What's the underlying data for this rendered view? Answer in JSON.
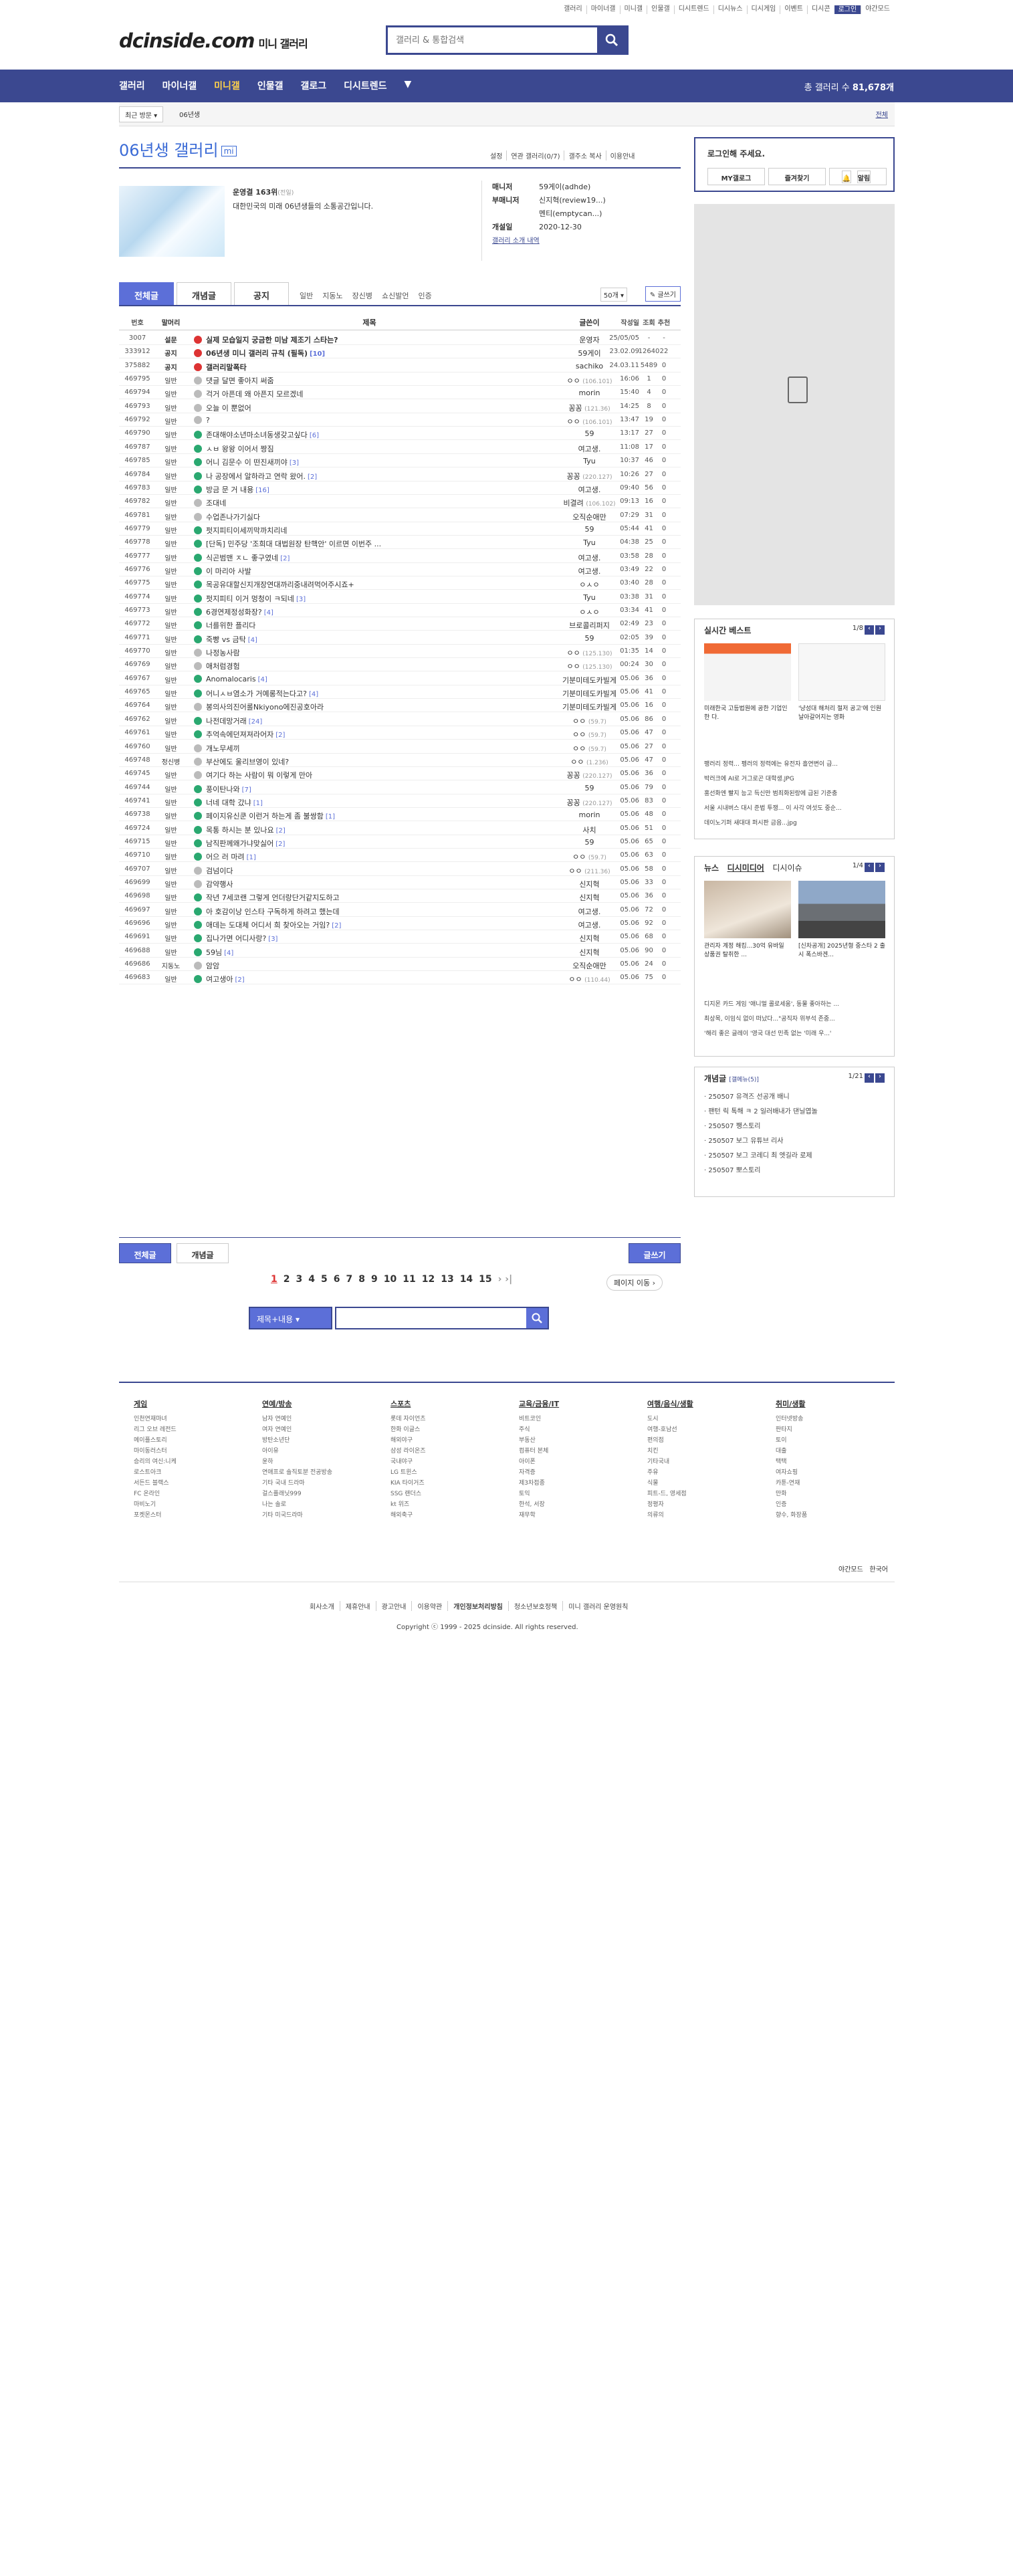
{
  "top_links": [
    "갤러리",
    "마이너갤",
    "미니갤",
    "인물갤",
    "디시트렌드",
    "디시뉴스",
    "디시게임",
    "이벤트",
    "디시콘",
    "로그인",
    "야간모드"
  ],
  "logo": "dcinside.com",
  "logo_sub": "미니 갤러리",
  "search_placeholder": "갤러리 & 통합검색",
  "nav": [
    "갤러리",
    "마이너갤",
    "미니갤",
    "인물갤",
    "갤로그",
    "디시트렌드"
  ],
  "nav_active": "미니갤",
  "nav_count_label": "총 갤러리 수",
  "nav_count": "81,678개",
  "breadcrumb": {
    "recent": "최근 방문",
    "item": "06년생",
    "all": "전체"
  },
  "gallery": {
    "title": "06년생 갤러리",
    "badge": "mi",
    "tools": [
      "설정",
      "연관 갤러리(0/7)",
      "갤주소 복사",
      "이용안내"
    ],
    "rank": "운영결 163위",
    "rank_note": "(전일)",
    "desc": "대한민국의 미래 06년생들의 소통공간입니다.",
    "manager_label": "매니저",
    "manager": "59게이(adhde)",
    "submanager_label": "부매니저",
    "submanager": "신지혁(review19...)",
    "submanager2": "멘티(emptycan...)",
    "opened_label": "개설일",
    "opened": "2020-12-30",
    "link": "갤러리 소개 내역"
  },
  "tabs": [
    "전체글",
    "개념글",
    "공지"
  ],
  "subtabs": [
    "일반",
    "지동노",
    "장신병",
    "쇼신발언",
    "인증"
  ],
  "list_count": "50개",
  "write_btn": "글쓰기",
  "header": [
    "번호",
    "말머리",
    "제목",
    "글쓴이",
    "작성일",
    "조회",
    "추천"
  ],
  "rows": [
    {
      "no": "3007",
      "h": "설문",
      "t": "실제 모습일지 궁금한 미남 제조기 스타는?",
      "w": "운영자",
      "d": "25/05/05",
      "v": "-",
      "r": "-",
      "ic": "r",
      "type": "notice"
    },
    {
      "no": "333912",
      "h": "공지",
      "t": "06년생 미니 갤러리 규칙 (필독)",
      "c": "[10]",
      "w": "59게이",
      "d": "23.02.09",
      "v": "12640",
      "r": "22",
      "ic": "r",
      "type": "notice"
    },
    {
      "no": "375882",
      "h": "공지",
      "t": "갤러리말폭타",
      "w": "sachiko",
      "d": "24.03.11",
      "v": "5489",
      "r": "0",
      "ic": "r",
      "type": "notice"
    },
    {
      "no": "469795",
      "h": "일반",
      "t": "댓글 달면 좋아지 써줌",
      "w": "ㅇㅇ",
      "ip": "(106.101)",
      "d": "16:06",
      "v": "1",
      "r": "0",
      "ic": "gray"
    },
    {
      "no": "469794",
      "h": "일반",
      "t": "걱거 아픈데 왜 아픈지 모르겠네",
      "w": "morin",
      "d": "15:40",
      "v": "4",
      "r": "0",
      "ic": "gray"
    },
    {
      "no": "469793",
      "h": "일반",
      "t": "오늘 이 뿐없어",
      "w": "꽁꽁",
      "ip": "(121.36)",
      "d": "14:25",
      "v": "8",
      "r": "0",
      "ic": "gray"
    },
    {
      "no": "469792",
      "h": "일반",
      "t": "?",
      "w": "ㅇㅇ",
      "ip": "(106.101)",
      "d": "13:47",
      "v": "19",
      "r": "0",
      "ic": "gray"
    },
    {
      "no": "469790",
      "h": "일반",
      "t": "존대해야소년마소녀동생갖고싶다",
      "c": "[6]",
      "w": "59",
      "d": "13:17",
      "v": "27",
      "r": "0",
      "ic": "g"
    },
    {
      "no": "469787",
      "h": "일반",
      "t": "ㅅㅂ 왕왕 이어서 짱짐",
      "w": "여고생.",
      "d": "11:08",
      "v": "17",
      "r": "0",
      "ic": "g"
    },
    {
      "no": "469785",
      "h": "일반",
      "t": "어니 김문수 이 떤진새끼야",
      "c": "[3]",
      "w": "Tyu",
      "d": "10:37",
      "v": "46",
      "r": "0",
      "ic": "g"
    },
    {
      "no": "469784",
      "h": "일반",
      "t": "나 공장에서 알하라고 연락 왔어.",
      "c": "[2]",
      "w": "꽁꽁",
      "ip": "(220.127)",
      "d": "10:26",
      "v": "27",
      "r": "0",
      "ic": "g"
    },
    {
      "no": "469783",
      "h": "일반",
      "t": "방금 문 거 내용",
      "c": "[16]",
      "w": "여고생.",
      "d": "09:40",
      "v": "56",
      "r": "0",
      "ic": "g"
    },
    {
      "no": "469782",
      "h": "일반",
      "t": "조대네",
      "w": "비결려",
      "ip": "(106.102)",
      "d": "09:13",
      "v": "16",
      "r": "0",
      "ic": "gray"
    },
    {
      "no": "469781",
      "h": "일반",
      "t": "수업존나가기싫다",
      "w": "오직순애만",
      "d": "07:29",
      "v": "31",
      "r": "0",
      "ic": "gray"
    },
    {
      "no": "469779",
      "h": "일반",
      "t": "펏지피티이세끼막까치리네",
      "w": "59",
      "d": "05:44",
      "v": "41",
      "r": "0",
      "ic": "g"
    },
    {
      "no": "469778",
      "h": "일반",
      "t": "[단독] 민주당 '조희대 대법원장 탄핵안' 이르면 이번주 ...",
      "w": "Tyu",
      "d": "04:38",
      "v": "25",
      "r": "0",
      "ic": "g"
    },
    {
      "no": "469777",
      "h": "일반",
      "t": "식곤범맨 ㅈㄴ 좋구였네",
      "c": "[2]",
      "w": "여고생.",
      "d": "03:58",
      "v": "28",
      "r": "0",
      "ic": "g"
    },
    {
      "no": "469776",
      "h": "일반",
      "t": "이 마리아 사발",
      "w": "여고생.",
      "d": "03:49",
      "v": "22",
      "r": "0",
      "ic": "g"
    },
    {
      "no": "469775",
      "h": "일반",
      "t": "목공유대할신지개장연대까리중내려먹어주시죠+",
      "w": "ㅇㅅㅇ",
      "d": "03:40",
      "v": "28",
      "r": "0",
      "ic": "g"
    },
    {
      "no": "469774",
      "h": "일반",
      "t": "펏지피티 이거 멍청이 ㅋ되네",
      "c": "[3]",
      "w": "Tyu",
      "d": "03:38",
      "v": "31",
      "r": "0",
      "ic": "g"
    },
    {
      "no": "469773",
      "h": "일반",
      "t": "6경연제정성화장?",
      "c": "[4]",
      "w": "ㅇㅅㅇ",
      "d": "03:34",
      "v": "41",
      "r": "0",
      "ic": "g"
    },
    {
      "no": "469772",
      "h": "일반",
      "t": "너를위한 플리다",
      "w": "브로콜리퍼지",
      "d": "02:49",
      "v": "23",
      "r": "0",
      "ic": "g"
    },
    {
      "no": "469771",
      "h": "일반",
      "t": "죽빵 vs 금탁",
      "c": "[4]",
      "w": "59",
      "d": "02:05",
      "v": "39",
      "r": "0",
      "ic": "g"
    },
    {
      "no": "469770",
      "h": "일반",
      "t": "나정농사람",
      "w": "ㅇㅇ",
      "ip": "(125.130)",
      "d": "01:35",
      "v": "14",
      "r": "0",
      "ic": "gray"
    },
    {
      "no": "469769",
      "h": "일반",
      "t": "애처럼경험",
      "w": "ㅇㅇ",
      "ip": "(125.130)",
      "d": "00:24",
      "v": "30",
      "r": "0",
      "ic": "gray"
    },
    {
      "no": "469767",
      "h": "일반",
      "t": "Anomalocaris",
      "c": "[4]",
      "w": "기분미테도카빌게",
      "d": "05.06",
      "v": "36",
      "r": "0",
      "ic": "g"
    },
    {
      "no": "469765",
      "h": "일반",
      "t": "어니ㅅㅂ염소가 거예롱적는다고?",
      "c": "[4]",
      "w": "기분미테도카빌게",
      "d": "05.06",
      "v": "41",
      "r": "0",
      "ic": "g"
    },
    {
      "no": "469764",
      "h": "일반",
      "t": "봉의사의진어롤Nkiyono에진공호아라",
      "w": "기분미테도카빌게",
      "d": "05.06",
      "v": "16",
      "r": "0",
      "ic": "gray"
    },
    {
      "no": "469762",
      "h": "일반",
      "t": "나전데망거래",
      "c": "[24]",
      "w": "ㅇㅇ",
      "ip": "(59.7)",
      "d": "05.06",
      "v": "86",
      "r": "0",
      "ic": "g"
    },
    {
      "no": "469761",
      "h": "일반",
      "t": "추억속에던져져라어자",
      "c": "[2]",
      "w": "ㅇㅇ",
      "ip": "(59.7)",
      "d": "05.06",
      "v": "47",
      "r": "0",
      "ic": "g"
    },
    {
      "no": "469760",
      "h": "일반",
      "t": "개노무세끼",
      "w": "ㅇㅇ",
      "ip": "(59.7)",
      "d": "05.06",
      "v": "27",
      "r": "0",
      "ic": "gray"
    },
    {
      "no": "469748",
      "h": "정신병",
      "t": "부산에도 울리브영이 있네?",
      "w": "ㅇㅇ",
      "ip": "(1.236)",
      "d": "05.06",
      "v": "47",
      "r": "0",
      "ic": "gray"
    },
    {
      "no": "469745",
      "h": "일반",
      "t": "여기다 하는 사람이 뭐 이렇게 만아",
      "w": "꽁꽁",
      "ip": "(220.127)",
      "d": "05.06",
      "v": "36",
      "r": "0",
      "ic": "gray"
    },
    {
      "no": "469744",
      "h": "일반",
      "t": "풍이탄나와",
      "c": "[7]",
      "w": "59",
      "d": "05.06",
      "v": "79",
      "r": "0",
      "ic": "g"
    },
    {
      "no": "469741",
      "h": "일반",
      "t": "너네 대학 갔냐",
      "c": "[1]",
      "w": "꽁꽁",
      "ip": "(220.127)",
      "d": "05.06",
      "v": "83",
      "r": "0",
      "ic": "g"
    },
    {
      "no": "469738",
      "h": "일반",
      "t": "페이지유신쿤 이런거 하는게 좀 불쌍함",
      "c": "[1]",
      "w": "morin",
      "d": "05.06",
      "v": "48",
      "r": "0",
      "ic": "g"
    },
    {
      "no": "469724",
      "h": "일반",
      "t": "목통 하시는 분 있나요",
      "c": "[2]",
      "w": "사치",
      "d": "05.06",
      "v": "51",
      "r": "0",
      "ic": "g"
    },
    {
      "no": "469715",
      "h": "일반",
      "t": "남직판께왜가냐맞싫어",
      "c": "[2]",
      "w": "59",
      "d": "05.06",
      "v": "65",
      "r": "0",
      "ic": "g"
    },
    {
      "no": "469710",
      "h": "일반",
      "t": "어으 러 마려",
      "c": "[1]",
      "w": "ㅇㅇ",
      "ip": "(59.7)",
      "d": "05.06",
      "v": "63",
      "r": "0",
      "ic": "g"
    },
    {
      "no": "469707",
      "h": "일반",
      "t": "검넘이다",
      "w": "ㅇㅇ",
      "ip": "(211.36)",
      "d": "05.06",
      "v": "58",
      "r": "0",
      "ic": "gray"
    },
    {
      "no": "469699",
      "h": "일반",
      "t": "감약행사",
      "w": "신지혁",
      "d": "05.06",
      "v": "33",
      "r": "0",
      "ic": "gray"
    },
    {
      "no": "469698",
      "h": "일반",
      "t": "작년 7세코랜 그렇게 언더랑단거같지도하고",
      "w": "신지혁",
      "d": "05.06",
      "v": "36",
      "r": "0",
      "ic": "g"
    },
    {
      "no": "469697",
      "h": "일반",
      "t": "아 호감이낭 인스타 구독하게 하려고 했는데",
      "w": "여고생.",
      "d": "05.06",
      "v": "72",
      "r": "0",
      "ic": "g"
    },
    {
      "no": "469696",
      "h": "일반",
      "t": "애데는 도대체 어디서 희 찾아오는 거임?",
      "c": "[2]",
      "w": "여고생.",
      "d": "05.06",
      "v": "92",
      "r": "0",
      "ic": "g"
    },
    {
      "no": "469691",
      "h": "일반",
      "t": "집나가면 어디사랑?",
      "c": "[3]",
      "w": "신지혁",
      "d": "05.06",
      "v": "68",
      "r": "0",
      "ic": "g"
    },
    {
      "no": "469688",
      "h": "일반",
      "t": "59님",
      "c": "[4]",
      "w": "신지혁",
      "d": "05.06",
      "v": "90",
      "r": "0",
      "ic": "g"
    },
    {
      "no": "469686",
      "h": "지동노",
      "t": "암암",
      "w": "오직순애만",
      "d": "05.06",
      "v": "24",
      "r": "0",
      "ic": "gray"
    },
    {
      "no": "469683",
      "h": "일반",
      "t": "여고생아",
      "c": "[2]",
      "w": "ㅇㅇ",
      "ip": "(110.44)",
      "d": "05.06",
      "v": "75",
      "r": "0",
      "ic": "g"
    }
  ],
  "bottom_btns": {
    "all": "전체글",
    "concept": "개념글",
    "write": "글쓰기"
  },
  "pages": [
    "1",
    "2",
    "3",
    "4",
    "5",
    "6",
    "7",
    "8",
    "9",
    "10",
    "11",
    "12",
    "13",
    "14",
    "15"
  ],
  "page_jump": "페이지 이동",
  "search_select": "제목+내용",
  "footer_cols": [
    {
      "title": "게임",
      "items": [
        "인천연재마녀",
        "리그 오브 레전드",
        "메이플스토리",
        "마이동러스터",
        "승리의 여신:니케",
        "로스트아크",
        "서든드 블랙스",
        "FC 온라인",
        "마비노기",
        "포켓몬스터"
      ]
    },
    {
      "title": "연예/방송",
      "items": [
        "남자 연예인",
        "여자 연예인",
        "방탄소년단",
        "아이유",
        "윤하",
        "연애프로 솔직토분 전공방송",
        "기타 국내 드라마",
        "걸스플래닛999",
        "나는 솔로",
        "기타 미국드라마"
      ]
    },
    {
      "title": "스포츠",
      "items": [
        "롯데 자이언츠",
        "한화 이글스",
        "해외야구",
        "삼성 라이온즈",
        "국내야구",
        "LG 트윈스",
        "KIA 타이거즈",
        "SSG 랜더스",
        "kt 위즈",
        "해외축구"
      ]
    },
    {
      "title": "교육/금융/IT",
      "items": [
        "비트코인",
        "주식",
        "부동산",
        "컴퓨터 본체",
        "아이폰",
        "자격증",
        "제3차접종",
        "토익",
        "한석, 서장",
        "재무학"
      ]
    },
    {
      "title": "여행/음식/생활",
      "items": [
        "도시",
        "여행-호남선",
        "편의점",
        "치킨",
        "기타국내",
        "주유",
        "식물",
        "피트-드, 영세점",
        "정평자",
        "의류의"
      ]
    },
    {
      "title": "취미/생활",
      "items": [
        "인터넷방송",
        "판타지",
        "토이",
        "대출",
        "택택",
        "여자쇼핑",
        "카툰-연재",
        "만화",
        "인증",
        "향수, 화장품"
      ]
    }
  ],
  "footer_flags": [
    "야간모드",
    "한국어"
  ],
  "footer_links": [
    "회사소개",
    "제휴안내",
    "광고안내",
    "이용약관",
    "개인정보처리방침",
    "청소년보호정책",
    "미니 갤러리 운영원칙"
  ],
  "copyright": "Copyright ⓒ 1999 - 2025 dcinside. All rights reserved.",
  "side": {
    "login_title": "로그인해 주세요.",
    "login_btns": [
      "MY갤로그",
      "즐겨찾기",
      "알림"
    ],
    "best_title": "실시간 베스트",
    "best_page": "1/8",
    "best_caps": [
      "미래한국 고등법원에 공한 기업인한 다.",
      "'냥성대 해처리 절저 공고'에 인원 날아갈어지는 영화"
    ],
    "best_list": [
      "팽러리 정력... 펭러의 정력에는 유전자 흘연변이 급...",
      "박러크에 AI로 거그로곤 대학생.JPG",
      "홍선화엔 빨지 능고 득신만 범죄화된랑에 급된 기준충",
      "서울 시내버스 대시 준법 투쟁... 이 사각 여섯도 중순...",
      "데이노기퍼 새대대 퍼시판 금음...jpg"
    ],
    "news_title": "뉴스",
    "news_tabs": [
      "디시미디어",
      "디시이슈"
    ],
    "news_page": "1/4",
    "news_caps": [
      "관리자 계정 해킹...30억 유바일 상품권 탈취한 ...",
      "[신차공개] 2025년형 중스타 2 출시 폭스바겐..."
    ],
    "news_list": [
      "디지몬 카드 게임 '애니멀 콜로세움', 동물 좋아하는 ...",
      "최상목, 이임식 없이 떠났다...\"공직자 위부석 존중...",
      "'해리 좋은 글레이 '영국 대선 민족 없는 '미래 우...'"
    ],
    "concept_title": "개념글",
    "concept_sub": "[갤메뉴(5)]",
    "concept_page": "1/21",
    "concept_list": [
      "250507 유격즈 선공개 배니",
      "팬턴 릭 톡해 ㅋ 2 일러배내가 댄닐엽놀",
      "250507 쨍스토리",
      "250507 보그 유튜브 리사",
      "250507 보그 코레디 최 엣길라 로제",
      "250507 뽀스토리"
    ]
  }
}
